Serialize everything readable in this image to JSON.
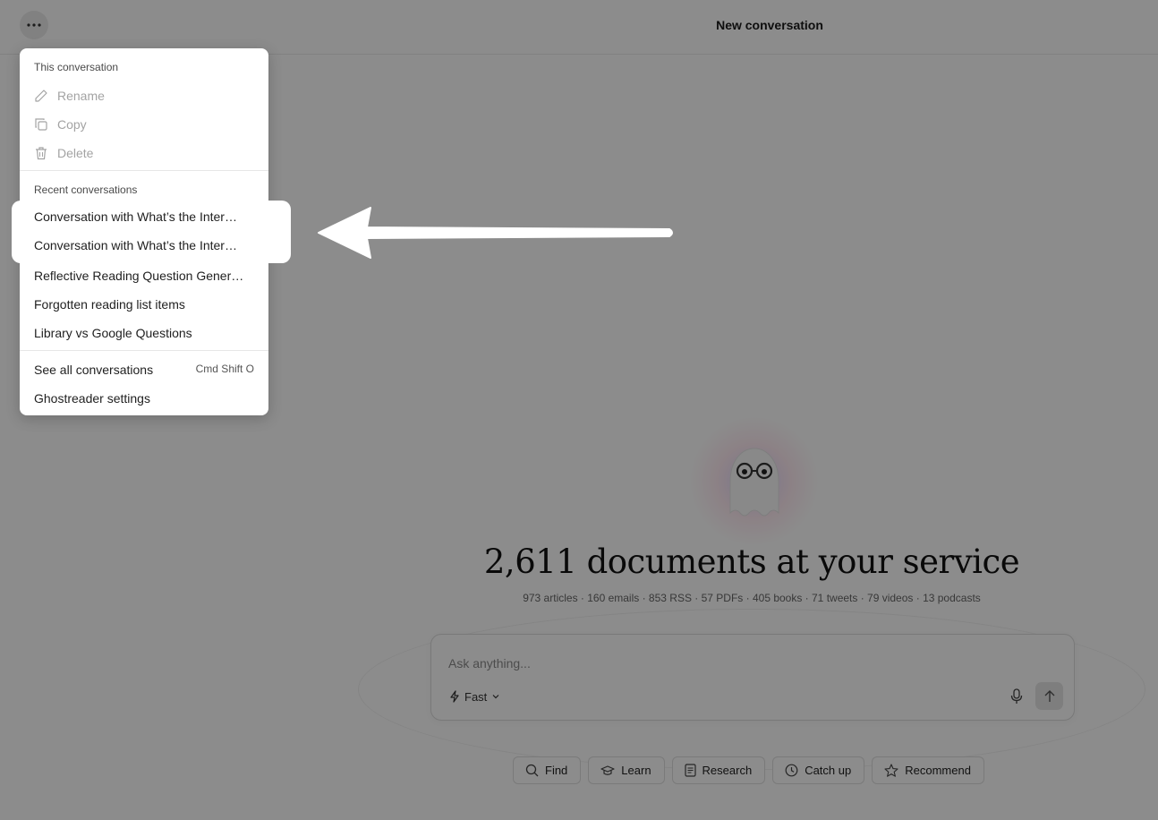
{
  "header": {
    "title": "New conversation"
  },
  "hero": {
    "headline": "2,611 documents at your service",
    "stats": "973 articles · 160 emails · 853 RSS · 57 PDFs · 405 books · 71 tweets · 79 videos · 13 podcasts"
  },
  "composer": {
    "placeholder": "Ask anything...",
    "mode_label": "Fast"
  },
  "chips": [
    {
      "label": "Find",
      "icon": "search-icon"
    },
    {
      "label": "Learn",
      "icon": "graduation-cap-icon"
    },
    {
      "label": "Research",
      "icon": "document-icon"
    },
    {
      "label": "Catch up",
      "icon": "clock-icon"
    },
    {
      "label": "Recommend",
      "icon": "star-icon"
    }
  ],
  "menu": {
    "this_conversation_title": "This conversation",
    "actions": [
      {
        "label": "Rename",
        "icon": "pencil-icon"
      },
      {
        "label": "Copy",
        "icon": "copy-icon"
      },
      {
        "label": "Delete",
        "icon": "trash-icon"
      }
    ],
    "recent_title": "Recent conversations",
    "recent": [
      "Conversation with What’s the Inter…",
      "Conversation with What’s the Inter…",
      "Reflective Reading Question Gener…",
      "Forgotten reading list items",
      "Library vs Google Questions"
    ],
    "see_all_label": "See all conversations",
    "see_all_shortcut": "Cmd Shift O",
    "settings_label": "Ghostreader settings"
  },
  "colors": {
    "overlay": "#000000",
    "accent": "#8b7cf6"
  }
}
